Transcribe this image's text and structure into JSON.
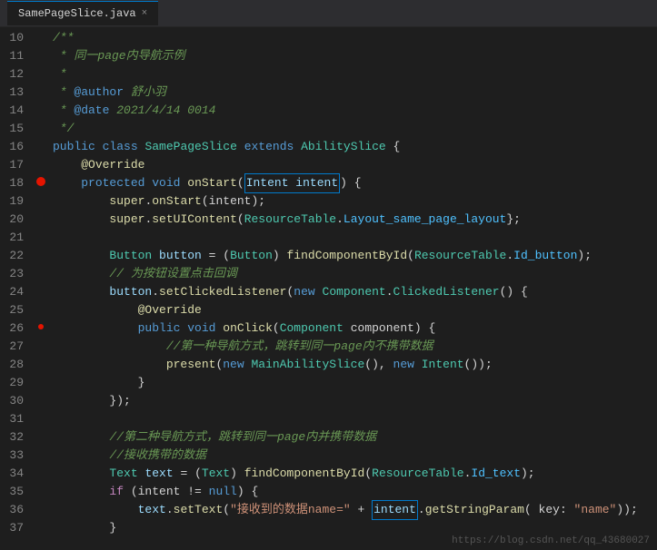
{
  "tab": {
    "filename": "SamePageSlice.java",
    "close_label": "×"
  },
  "lines": [
    {
      "num": "10",
      "tokens": [
        {
          "t": "javadoc",
          "v": "/**"
        }
      ],
      "fold": true,
      "foldPos": "open"
    },
    {
      "num": "11",
      "tokens": [
        {
          "t": "javadoc",
          "v": " * 同一page内导航示例"
        }
      ]
    },
    {
      "num": "12",
      "tokens": [
        {
          "t": "javadoc",
          "v": " *"
        }
      ]
    },
    {
      "num": "13",
      "tokens": [
        {
          "t": "javadoc",
          "v": " * "
        },
        {
          "t": "javadoc-tag",
          "v": "@author"
        },
        {
          "t": "javadoc",
          "v": " 舒小羽"
        }
      ]
    },
    {
      "num": "14",
      "tokens": [
        {
          "t": "javadoc",
          "v": " * "
        },
        {
          "t": "javadoc-tag",
          "v": "@date"
        },
        {
          "t": "javadoc",
          "v": " 2021/4/14 0014"
        }
      ]
    },
    {
      "num": "15",
      "tokens": [
        {
          "t": "javadoc",
          "v": " */"
        }
      ],
      "fold": true,
      "foldPos": "close"
    },
    {
      "num": "16",
      "tokens": [
        {
          "t": "kw",
          "v": "public"
        },
        {
          "t": "plain",
          "v": " "
        },
        {
          "t": "kw",
          "v": "class"
        },
        {
          "t": "plain",
          "v": " "
        },
        {
          "t": "cn",
          "v": "SamePageSlice"
        },
        {
          "t": "plain",
          "v": " "
        },
        {
          "t": "kw",
          "v": "extends"
        },
        {
          "t": "plain",
          "v": " "
        },
        {
          "t": "cn",
          "v": "AbilitySlice"
        },
        {
          "t": "plain",
          "v": " {"
        }
      ]
    },
    {
      "num": "17",
      "tokens": [
        {
          "t": "plain",
          "v": "    "
        },
        {
          "t": "annotation",
          "v": "@Override"
        }
      ]
    },
    {
      "num": "18",
      "tokens": [
        {
          "t": "plain",
          "v": "    "
        },
        {
          "t": "kw",
          "v": "protected"
        },
        {
          "t": "plain",
          "v": " "
        },
        {
          "t": "kw",
          "v": "void"
        },
        {
          "t": "plain",
          "v": " "
        },
        {
          "t": "method",
          "v": "onStart"
        },
        {
          "t": "plain",
          "v": "("
        },
        {
          "t": "highlight",
          "v": "Intent intent"
        },
        {
          "t": "plain",
          "v": ") {"
        }
      ],
      "highlighted": false,
      "breakpoint": true,
      "debugarrow": true
    },
    {
      "num": "19",
      "tokens": [
        {
          "t": "plain",
          "v": "        "
        },
        {
          "t": "method",
          "v": "super"
        },
        {
          "t": "plain",
          "v": "."
        },
        {
          "t": "method",
          "v": "onStart"
        },
        {
          "t": "plain",
          "v": "(intent);"
        }
      ]
    },
    {
      "num": "20",
      "tokens": [
        {
          "t": "plain",
          "v": "        "
        },
        {
          "t": "method",
          "v": "super"
        },
        {
          "t": "plain",
          "v": "."
        },
        {
          "t": "method",
          "v": "setUIContent"
        },
        {
          "t": "plain",
          "v": "("
        },
        {
          "t": "cn",
          "v": "ResourceTable"
        },
        {
          "t": "plain",
          "v": "."
        },
        {
          "t": "static-member",
          "v": "Layout_same_page_layout"
        },
        {
          "t": "plain",
          "v": "};"
        }
      ]
    },
    {
      "num": "21",
      "tokens": [
        {
          "t": "plain",
          "v": ""
        }
      ]
    },
    {
      "num": "22",
      "tokens": [
        {
          "t": "plain",
          "v": "        "
        },
        {
          "t": "cn",
          "v": "Button"
        },
        {
          "t": "plain",
          "v": " "
        },
        {
          "t": "field",
          "v": "button"
        },
        {
          "t": "plain",
          "v": " = ("
        },
        {
          "t": "cn",
          "v": "Button"
        },
        {
          "t": "plain",
          "v": ") "
        },
        {
          "t": "method",
          "v": "findComponentById"
        },
        {
          "t": "plain",
          "v": "("
        },
        {
          "t": "cn",
          "v": "ResourceTable"
        },
        {
          "t": "plain",
          "v": "."
        },
        {
          "t": "static-member",
          "v": "Id_button"
        },
        {
          "t": "plain",
          "v": ");"
        }
      ]
    },
    {
      "num": "23",
      "tokens": [
        {
          "t": "comment",
          "v": "        // 为按钮设置点击回调"
        }
      ]
    },
    {
      "num": "24",
      "tokens": [
        {
          "t": "plain",
          "v": "        "
        },
        {
          "t": "field",
          "v": "button"
        },
        {
          "t": "plain",
          "v": "."
        },
        {
          "t": "method",
          "v": "setClickedListener"
        },
        {
          "t": "plain",
          "v": "("
        },
        {
          "t": "kw",
          "v": "new"
        },
        {
          "t": "plain",
          "v": " "
        },
        {
          "t": "cn",
          "v": "Component"
        },
        {
          "t": "plain",
          "v": "."
        },
        {
          "t": "cn",
          "v": "ClickedListener"
        },
        {
          "t": "plain",
          "v": "() {"
        }
      ]
    },
    {
      "num": "25",
      "tokens": [
        {
          "t": "plain",
          "v": "            "
        },
        {
          "t": "annotation",
          "v": "@Override"
        }
      ]
    },
    {
      "num": "26",
      "tokens": [
        {
          "t": "plain",
          "v": "            "
        },
        {
          "t": "kw",
          "v": "public"
        },
        {
          "t": "plain",
          "v": " "
        },
        {
          "t": "kw",
          "v": "void"
        },
        {
          "t": "plain",
          "v": " "
        },
        {
          "t": "method",
          "v": "onClick"
        },
        {
          "t": "plain",
          "v": "("
        },
        {
          "t": "cn",
          "v": "Component"
        },
        {
          "t": "plain",
          "v": " component) {"
        }
      ],
      "breakpoint2": true
    },
    {
      "num": "27",
      "tokens": [
        {
          "t": "comment",
          "v": "                //第一种导航方式，跳转到同一page内不携带数据"
        }
      ]
    },
    {
      "num": "28",
      "tokens": [
        {
          "t": "plain",
          "v": "                "
        },
        {
          "t": "method",
          "v": "present"
        },
        {
          "t": "plain",
          "v": "("
        },
        {
          "t": "kw",
          "v": "new"
        },
        {
          "t": "plain",
          "v": " "
        },
        {
          "t": "cn",
          "v": "MainAbilitySlice"
        },
        {
          "t": "plain",
          "v": "(), "
        },
        {
          "t": "kw",
          "v": "new"
        },
        {
          "t": "plain",
          "v": " "
        },
        {
          "t": "cn",
          "v": "Intent"
        },
        {
          "t": "plain",
          "v": "());"
        }
      ]
    },
    {
      "num": "29",
      "tokens": [
        {
          "t": "plain",
          "v": "            }"
        }
      ]
    },
    {
      "num": "30",
      "tokens": [
        {
          "t": "plain",
          "v": "        });"
        }
      ]
    },
    {
      "num": "31",
      "tokens": [
        {
          "t": "plain",
          "v": ""
        }
      ]
    },
    {
      "num": "32",
      "tokens": [
        {
          "t": "comment",
          "v": "        //第二种导航方式，跳转到同一page内并携带数据"
        }
      ]
    },
    {
      "num": "33",
      "tokens": [
        {
          "t": "comment",
          "v": "        //接收携带的数据"
        }
      ]
    },
    {
      "num": "34",
      "tokens": [
        {
          "t": "plain",
          "v": "        "
        },
        {
          "t": "cn",
          "v": "Text"
        },
        {
          "t": "plain",
          "v": " "
        },
        {
          "t": "field",
          "v": "text"
        },
        {
          "t": "plain",
          "v": " = ("
        },
        {
          "t": "cn",
          "v": "Text"
        },
        {
          "t": "plain",
          "v": ") "
        },
        {
          "t": "method",
          "v": "findComponentById"
        },
        {
          "t": "plain",
          "v": "("
        },
        {
          "t": "cn",
          "v": "ResourceTable"
        },
        {
          "t": "plain",
          "v": "."
        },
        {
          "t": "static-member",
          "v": "Id_text"
        },
        {
          "t": "plain",
          "v": ");"
        }
      ]
    },
    {
      "num": "35",
      "tokens": [
        {
          "t": "plain",
          "v": "        "
        },
        {
          "t": "kw2",
          "v": "if"
        },
        {
          "t": "plain",
          "v": " (intent != "
        },
        {
          "t": "kw",
          "v": "null"
        },
        {
          "t": "plain",
          "v": ") {"
        }
      ]
    },
    {
      "num": "36",
      "tokens": [
        {
          "t": "plain",
          "v": "            "
        },
        {
          "t": "field",
          "v": "text"
        },
        {
          "t": "plain",
          "v": "."
        },
        {
          "t": "method",
          "v": "setText"
        },
        {
          "t": "plain",
          "v": "("
        },
        {
          "t": "str",
          "v": "\"接收到的数据name=\""
        },
        {
          "t": "plain",
          "v": " + "
        },
        {
          "t": "highlight2",
          "v": "intent"
        },
        {
          "t": "plain",
          "v": "."
        },
        {
          "t": "method",
          "v": "getStringParam"
        },
        {
          "t": "plain",
          "v": "( key: "
        },
        {
          "t": "str",
          "v": "\"name\""
        },
        {
          "t": "plain",
          "v": "));"
        }
      ]
    },
    {
      "num": "37",
      "tokens": [
        {
          "t": "plain",
          "v": "        }"
        }
      ]
    }
  ],
  "watermark": "https://blog.csdn.net/qq_43680027"
}
